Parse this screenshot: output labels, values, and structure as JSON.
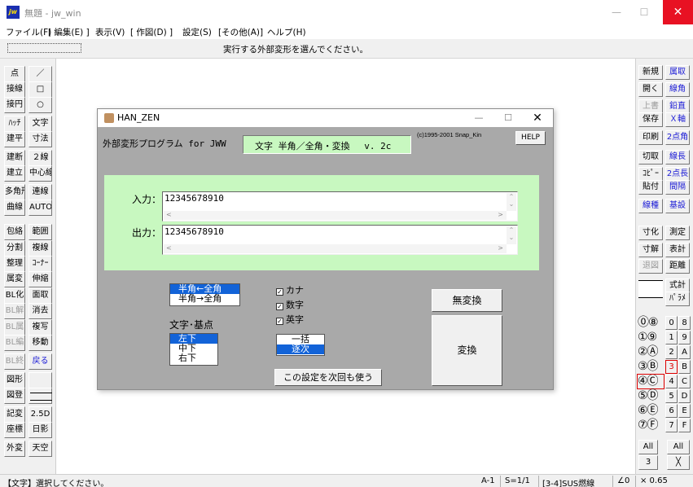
{
  "window": {
    "title": "無題 - jw_win",
    "app_icon": "jw",
    "minimize": "—",
    "maximize": "☐",
    "close": "✕"
  },
  "menu": [
    "ファイル(F)",
    "[ 編集(E) ]",
    "表示(V)",
    "[ 作図(D) ]",
    "設定(S)",
    "[その他(A)]",
    "ヘルプ(H)"
  ],
  "message": "実行する外部変形を選んでください。",
  "left_toolbar": [
    [
      "点",
      "／"
    ],
    [
      "接線",
      "□"
    ],
    [
      "接円",
      "○"
    ],
    [
      "ﾊｯﾁ",
      "文字"
    ],
    [
      "建平",
      "寸法"
    ],
    [
      "建断",
      "２線"
    ],
    [
      "建立",
      "中心線"
    ],
    [
      "多角形",
      "連線"
    ],
    [
      "曲線",
      "AUTO"
    ],
    [
      "包絡",
      "範囲"
    ],
    [
      "分割",
      "複線"
    ],
    [
      "整理",
      "ｺｰﾅｰ"
    ],
    [
      "属変",
      "伸縮"
    ],
    [
      "BL化",
      "面取"
    ],
    [
      "BL解",
      "消去"
    ],
    [
      "BL属",
      "複写"
    ],
    [
      "BL編",
      "移動"
    ],
    [
      "BL終",
      "戻る"
    ],
    [
      "図形",
      ""
    ],
    [
      "図登",
      ""
    ],
    [
      "記変",
      "2.5D"
    ],
    [
      "座標",
      "日影"
    ],
    [
      "外変",
      "天空"
    ]
  ],
  "right_toolbar": [
    [
      "新規",
      "属取"
    ],
    [
      "開く",
      "線角"
    ],
    [
      "上書",
      "鉛直"
    ],
    [
      "保存",
      "Ｘ軸"
    ],
    [
      "印刷",
      "2点角"
    ],
    [
      "切取",
      "線長"
    ],
    [
      "ｺﾋﾟｰ",
      "2点長"
    ],
    [
      "貼付",
      "間隔"
    ],
    [
      "線種",
      "基設"
    ],
    [
      "寸化",
      "測定"
    ],
    [
      "寸解",
      "表計"
    ],
    [
      "退図",
      "距離"
    ],
    [
      "",
      "式計"
    ],
    [
      "",
      "ﾊﾟﾗﾒ"
    ]
  ],
  "layer_rows": [
    [
      "⓪⑧",
      "0",
      "8"
    ],
    [
      "①⑨",
      "1",
      "9"
    ],
    [
      "②Ⓐ",
      "2",
      "A"
    ],
    [
      "③Ⓑ",
      "3",
      "B"
    ],
    [
      "④Ⓒ",
      "4",
      "C"
    ],
    [
      "⑤Ⓓ",
      "5",
      "D"
    ],
    [
      "⑥Ⓔ",
      "6",
      "E"
    ],
    [
      "⑦Ⓕ",
      "7",
      "F"
    ]
  ],
  "layer_all": [
    "All",
    "All"
  ],
  "layer_bottom": [
    "3",
    "╳"
  ],
  "status": {
    "hint": "【文字】選択してください。",
    "paper": "A-1",
    "scale": "S=1/1",
    "layer": "[3-4]SUS燃線",
    "angle": "∠0",
    "zoom": "× 0.65"
  },
  "dialog": {
    "title": "HAN_ZEN",
    "header": "外部変形プログラム for JWW",
    "program_name": "文字 半角／全角・変換　 v. 2c",
    "copyright": "(c)1995-2001 Snap_Kin",
    "help": "HELP",
    "input_label": "入力：",
    "input_value": "12345678910",
    "output_label": "出力：",
    "output_value": "12345678910",
    "mode_options": [
      "半角←全角",
      "半角→全角"
    ],
    "mode_selected": 0,
    "basepoint_label": "文字･基点",
    "basepoint_options": [
      "左下",
      "中下",
      "右下"
    ],
    "basepoint_selected": 0,
    "checks": [
      {
        "label": "カナ",
        "checked": true
      },
      {
        "label": "数字",
        "checked": true
      },
      {
        "label": "英字",
        "checked": true
      }
    ],
    "batch_options": [
      "一括",
      "逐次"
    ],
    "batch_selected": 1,
    "no_convert": "無変換",
    "convert": "変換",
    "save_settings": "この設定を次回も使う"
  },
  "colors": {
    "green_panel": "#c8f8c0",
    "highlight": "#1263d8",
    "dialog_bg": "#a9a9a9"
  }
}
